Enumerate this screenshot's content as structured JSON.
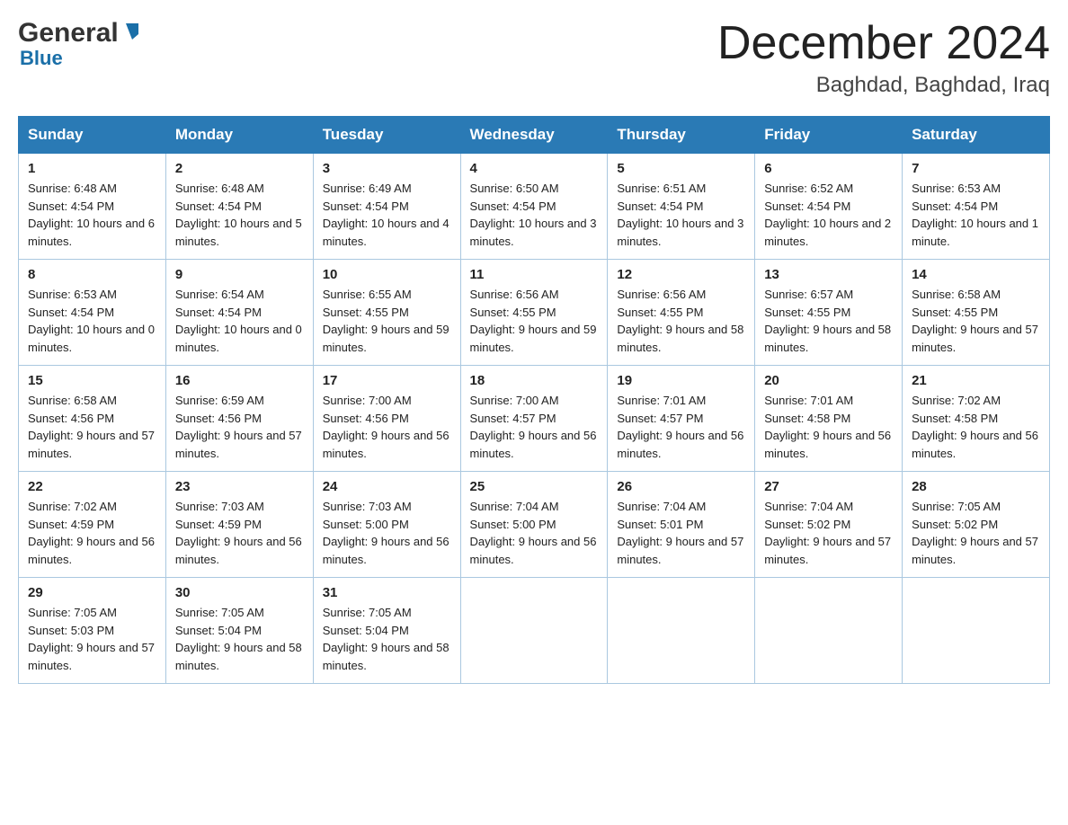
{
  "header": {
    "logo_general": "General",
    "logo_blue": "Blue",
    "month_title": "December 2024",
    "location": "Baghdad, Baghdad, Iraq"
  },
  "days_of_week": [
    "Sunday",
    "Monday",
    "Tuesday",
    "Wednesday",
    "Thursday",
    "Friday",
    "Saturday"
  ],
  "weeks": [
    [
      {
        "day": "1",
        "sunrise": "Sunrise: 6:48 AM",
        "sunset": "Sunset: 4:54 PM",
        "daylight": "Daylight: 10 hours and 6 minutes."
      },
      {
        "day": "2",
        "sunrise": "Sunrise: 6:48 AM",
        "sunset": "Sunset: 4:54 PM",
        "daylight": "Daylight: 10 hours and 5 minutes."
      },
      {
        "day": "3",
        "sunrise": "Sunrise: 6:49 AM",
        "sunset": "Sunset: 4:54 PM",
        "daylight": "Daylight: 10 hours and 4 minutes."
      },
      {
        "day": "4",
        "sunrise": "Sunrise: 6:50 AM",
        "sunset": "Sunset: 4:54 PM",
        "daylight": "Daylight: 10 hours and 3 minutes."
      },
      {
        "day": "5",
        "sunrise": "Sunrise: 6:51 AM",
        "sunset": "Sunset: 4:54 PM",
        "daylight": "Daylight: 10 hours and 3 minutes."
      },
      {
        "day": "6",
        "sunrise": "Sunrise: 6:52 AM",
        "sunset": "Sunset: 4:54 PM",
        "daylight": "Daylight: 10 hours and 2 minutes."
      },
      {
        "day": "7",
        "sunrise": "Sunrise: 6:53 AM",
        "sunset": "Sunset: 4:54 PM",
        "daylight": "Daylight: 10 hours and 1 minute."
      }
    ],
    [
      {
        "day": "8",
        "sunrise": "Sunrise: 6:53 AM",
        "sunset": "Sunset: 4:54 PM",
        "daylight": "Daylight: 10 hours and 0 minutes."
      },
      {
        "day": "9",
        "sunrise": "Sunrise: 6:54 AM",
        "sunset": "Sunset: 4:54 PM",
        "daylight": "Daylight: 10 hours and 0 minutes."
      },
      {
        "day": "10",
        "sunrise": "Sunrise: 6:55 AM",
        "sunset": "Sunset: 4:55 PM",
        "daylight": "Daylight: 9 hours and 59 minutes."
      },
      {
        "day": "11",
        "sunrise": "Sunrise: 6:56 AM",
        "sunset": "Sunset: 4:55 PM",
        "daylight": "Daylight: 9 hours and 59 minutes."
      },
      {
        "day": "12",
        "sunrise": "Sunrise: 6:56 AM",
        "sunset": "Sunset: 4:55 PM",
        "daylight": "Daylight: 9 hours and 58 minutes."
      },
      {
        "day": "13",
        "sunrise": "Sunrise: 6:57 AM",
        "sunset": "Sunset: 4:55 PM",
        "daylight": "Daylight: 9 hours and 58 minutes."
      },
      {
        "day": "14",
        "sunrise": "Sunrise: 6:58 AM",
        "sunset": "Sunset: 4:55 PM",
        "daylight": "Daylight: 9 hours and 57 minutes."
      }
    ],
    [
      {
        "day": "15",
        "sunrise": "Sunrise: 6:58 AM",
        "sunset": "Sunset: 4:56 PM",
        "daylight": "Daylight: 9 hours and 57 minutes."
      },
      {
        "day": "16",
        "sunrise": "Sunrise: 6:59 AM",
        "sunset": "Sunset: 4:56 PM",
        "daylight": "Daylight: 9 hours and 57 minutes."
      },
      {
        "day": "17",
        "sunrise": "Sunrise: 7:00 AM",
        "sunset": "Sunset: 4:56 PM",
        "daylight": "Daylight: 9 hours and 56 minutes."
      },
      {
        "day": "18",
        "sunrise": "Sunrise: 7:00 AM",
        "sunset": "Sunset: 4:57 PM",
        "daylight": "Daylight: 9 hours and 56 minutes."
      },
      {
        "day": "19",
        "sunrise": "Sunrise: 7:01 AM",
        "sunset": "Sunset: 4:57 PM",
        "daylight": "Daylight: 9 hours and 56 minutes."
      },
      {
        "day": "20",
        "sunrise": "Sunrise: 7:01 AM",
        "sunset": "Sunset: 4:58 PM",
        "daylight": "Daylight: 9 hours and 56 minutes."
      },
      {
        "day": "21",
        "sunrise": "Sunrise: 7:02 AM",
        "sunset": "Sunset: 4:58 PM",
        "daylight": "Daylight: 9 hours and 56 minutes."
      }
    ],
    [
      {
        "day": "22",
        "sunrise": "Sunrise: 7:02 AM",
        "sunset": "Sunset: 4:59 PM",
        "daylight": "Daylight: 9 hours and 56 minutes."
      },
      {
        "day": "23",
        "sunrise": "Sunrise: 7:03 AM",
        "sunset": "Sunset: 4:59 PM",
        "daylight": "Daylight: 9 hours and 56 minutes."
      },
      {
        "day": "24",
        "sunrise": "Sunrise: 7:03 AM",
        "sunset": "Sunset: 5:00 PM",
        "daylight": "Daylight: 9 hours and 56 minutes."
      },
      {
        "day": "25",
        "sunrise": "Sunrise: 7:04 AM",
        "sunset": "Sunset: 5:00 PM",
        "daylight": "Daylight: 9 hours and 56 minutes."
      },
      {
        "day": "26",
        "sunrise": "Sunrise: 7:04 AM",
        "sunset": "Sunset: 5:01 PM",
        "daylight": "Daylight: 9 hours and 57 minutes."
      },
      {
        "day": "27",
        "sunrise": "Sunrise: 7:04 AM",
        "sunset": "Sunset: 5:02 PM",
        "daylight": "Daylight: 9 hours and 57 minutes."
      },
      {
        "day": "28",
        "sunrise": "Sunrise: 7:05 AM",
        "sunset": "Sunset: 5:02 PM",
        "daylight": "Daylight: 9 hours and 57 minutes."
      }
    ],
    [
      {
        "day": "29",
        "sunrise": "Sunrise: 7:05 AM",
        "sunset": "Sunset: 5:03 PM",
        "daylight": "Daylight: 9 hours and 57 minutes."
      },
      {
        "day": "30",
        "sunrise": "Sunrise: 7:05 AM",
        "sunset": "Sunset: 5:04 PM",
        "daylight": "Daylight: 9 hours and 58 minutes."
      },
      {
        "day": "31",
        "sunrise": "Sunrise: 7:05 AM",
        "sunset": "Sunset: 5:04 PM",
        "daylight": "Daylight: 9 hours and 58 minutes."
      },
      null,
      null,
      null,
      null
    ]
  ]
}
